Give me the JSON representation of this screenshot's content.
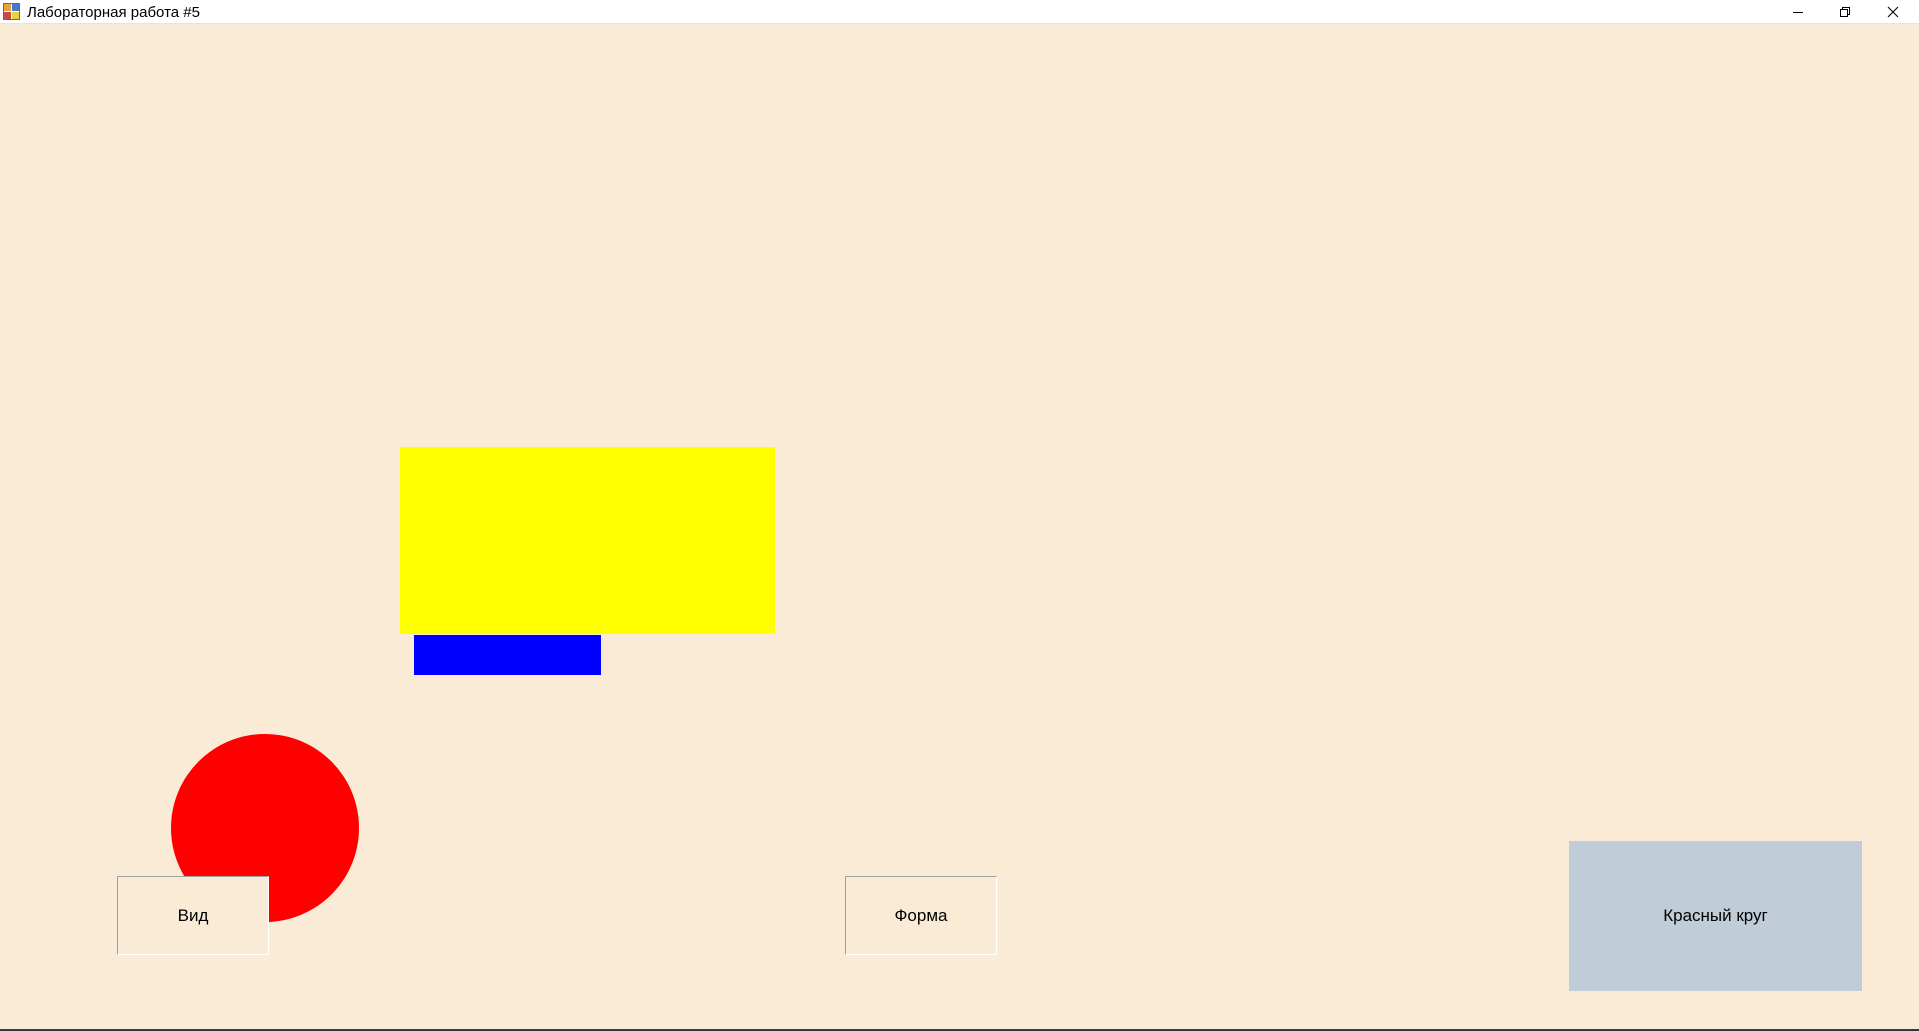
{
  "window": {
    "title": "Лабораторная работа #5",
    "icon": "app-form-icon",
    "controls": [
      "minimize-icon",
      "restore-icon",
      "close-icon"
    ]
  },
  "canvas": {
    "background": "#FAEBD7",
    "shapes": [
      {
        "name": "yellow-rectangle",
        "color": "#FFFF00"
      },
      {
        "name": "blue-rectangle",
        "color": "#0000FF"
      },
      {
        "name": "red-circle",
        "color": "#FF0000"
      }
    ]
  },
  "buttons": {
    "vid_label": "Вид",
    "forma_label": "Форма",
    "red_circle_label": "Красный круг",
    "red_circle_bg": "#C0CCD8"
  }
}
